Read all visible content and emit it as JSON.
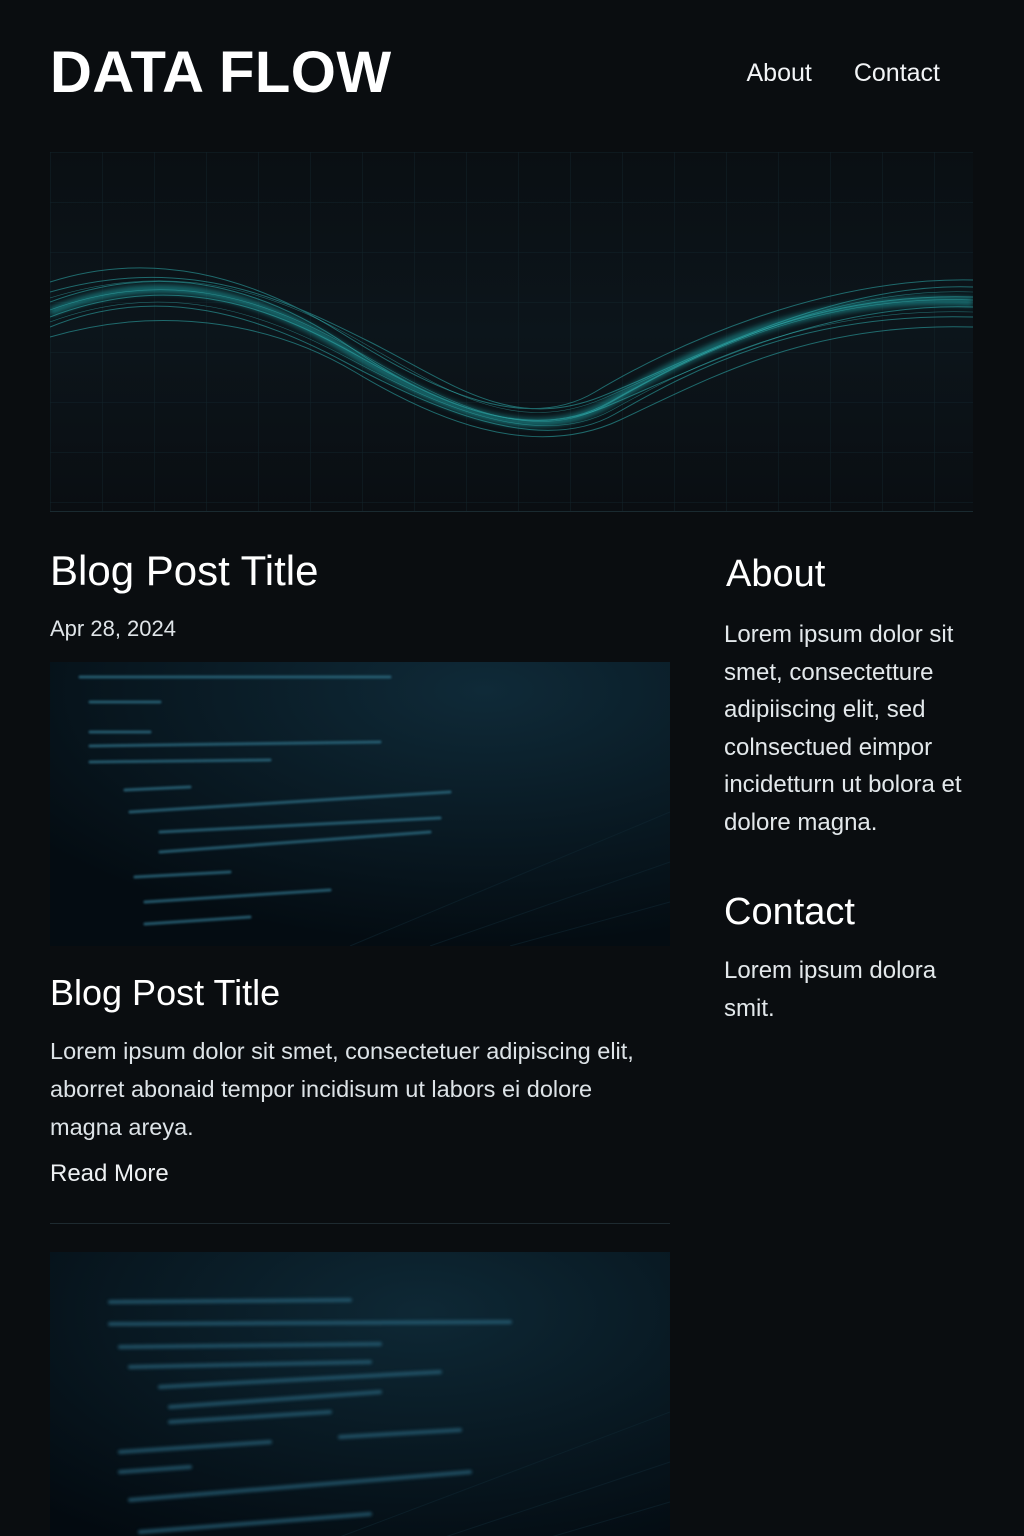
{
  "site": {
    "logo": "DATA FLOW",
    "nav": [
      {
        "label": "About"
      },
      {
        "label": "Contact"
      }
    ]
  },
  "main": {
    "featured_post": {
      "title": "Blog Post Title",
      "date": "Apr 28, 2024"
    },
    "post": {
      "title": "Blog Post Title",
      "excerpt": "Lorem ipsum dolor sit smet, consectetuer adipiscing elit, aborret abonaid tempor incidisum ut labors ei dolore magna areya.",
      "read_more": "Read More"
    }
  },
  "sidebar": {
    "about": {
      "title": "About",
      "text": "Lorem ipsum dolor sit smet, consectetture adipiiscing elit, sed colnsectued eimpor incidetturn ut bolora et dolore magna."
    },
    "contact": {
      "title": "Contact",
      "text": "Lorem ipsum dolora smit."
    }
  },
  "colors": {
    "background": "#0a0d10",
    "accent": "#2aa3a3",
    "text": "#e8ecef"
  }
}
